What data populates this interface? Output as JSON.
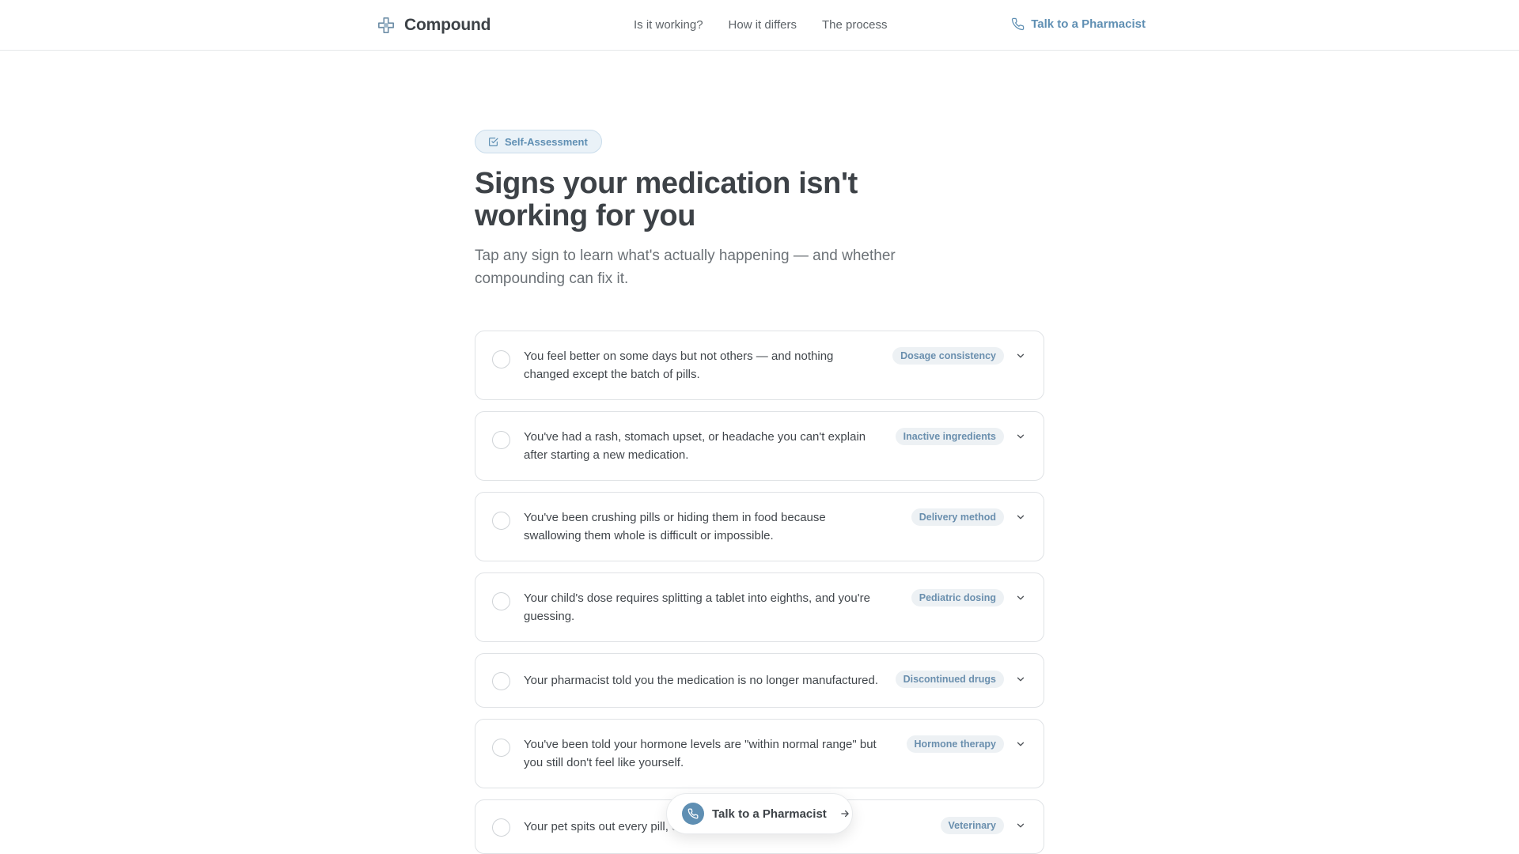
{
  "brand": {
    "name": "Compound",
    "icon": "plus-cross-icon"
  },
  "nav": [
    {
      "label": "Is it working?"
    },
    {
      "label": "How it differs"
    },
    {
      "label": "The process"
    }
  ],
  "header_cta": {
    "label": "Talk to a Pharmacist",
    "icon": "phone-icon"
  },
  "badge": {
    "label": "Self-Assessment",
    "icon": "checkbox-edit-icon"
  },
  "hero": {
    "title": "Signs your medication isn't working for you",
    "subtitle": "Tap any sign to learn what's actually happening — and whether compounding can fix it."
  },
  "signs": [
    {
      "text": "You feel better on some days but not others — and nothing changed except the batch of pills.",
      "tag": "Dosage consistency"
    },
    {
      "text": "You've had a rash, stomach upset, or headache you can't explain after starting a new medication.",
      "tag": "Inactive ingredients"
    },
    {
      "text": "You've been crushing pills or hiding them in food because swallowing them whole is difficult or impossible.",
      "tag": "Delivery method"
    },
    {
      "text": "Your child's dose requires splitting a tablet into eighths, and you're guessing.",
      "tag": "Pediatric dosing"
    },
    {
      "text": "Your pharmacist told you the medication is no longer manufactured.",
      "tag": "Discontinued drugs"
    },
    {
      "text": "You've been told your hormone levels are \"within normal range\" but you still don't feel like yourself.",
      "tag": "Hormone therapy"
    },
    {
      "text": "Your pet spits out every pill, e",
      "tag": "Veterinary"
    }
  ],
  "floating_cta": {
    "label": "Talk to a Pharmacist",
    "icon": "phone-icon",
    "arrow_icon": "arrow-right-icon"
  },
  "colors": {
    "accent": "#5f8fb3",
    "text": "#3d4247",
    "muted": "#6c7277",
    "border": "#dfe2e5",
    "tag_bg": "#edf1f4"
  }
}
